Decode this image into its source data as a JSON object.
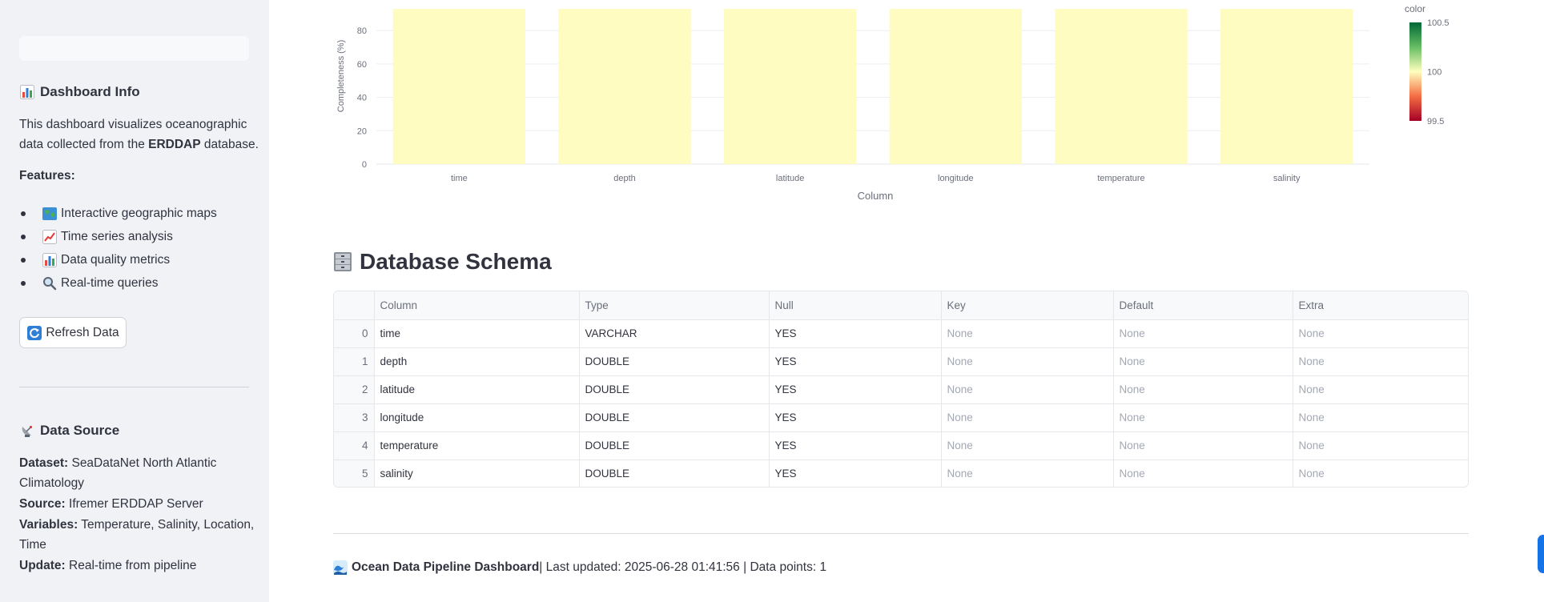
{
  "sidebar": {
    "dashboard_info": {
      "heading": "Dashboard Info",
      "description_prefix": "This dashboard visualizes oceanographic data collected from the ",
      "description_bold": "ERDDAP",
      "description_suffix": " database.",
      "features_label": "Features:",
      "features": [
        {
          "icon": "world-map-icon",
          "label": "Interactive geographic maps"
        },
        {
          "icon": "chart-increasing-icon",
          "label": "Time series analysis"
        },
        {
          "icon": "bar-chart-icon",
          "label": "Data quality metrics"
        },
        {
          "icon": "magnifier-icon",
          "label": "Real-time queries"
        }
      ]
    },
    "refresh_button": "Refresh Data",
    "data_source": {
      "heading": "Data Source",
      "dataset_label": "Dataset:",
      "dataset_value": " SeaDataNet North Atlantic Climatology",
      "source_label": "Source:",
      "source_value": " Ifremer ERDDAP Server",
      "variables_label": "Variables:",
      "variables_value": " Temperature, Salinity, Location, Time",
      "update_label": "Update:",
      "update_value": " Real-time from pipeline"
    }
  },
  "chart_data": {
    "type": "bar",
    "categories": [
      "time",
      "depth",
      "latitude",
      "longitude",
      "temperature",
      "salinity"
    ],
    "values": [
      100,
      100,
      100,
      100,
      100,
      100
    ],
    "xlabel": "Column",
    "ylabel": "Completeness (%)",
    "yticks": [
      0,
      20,
      40,
      60,
      80
    ],
    "ylim": [
      0,
      93
    ],
    "grid": true,
    "colorbar": {
      "title": "color",
      "ticks": [
        "100.5",
        "100",
        "99.5"
      ],
      "range": [
        99.5,
        100.5
      ]
    },
    "bar_color": "#fefcc0"
  },
  "schema": {
    "heading": "Database Schema",
    "columns": [
      "",
      "Column",
      "Type",
      "Null",
      "Key",
      "Default",
      "Extra"
    ],
    "rows": [
      [
        "0",
        "time",
        "VARCHAR",
        "YES",
        "None",
        "None",
        "None"
      ],
      [
        "1",
        "depth",
        "DOUBLE",
        "YES",
        "None",
        "None",
        "None"
      ],
      [
        "2",
        "latitude",
        "DOUBLE",
        "YES",
        "None",
        "None",
        "None"
      ],
      [
        "3",
        "longitude",
        "DOUBLE",
        "YES",
        "None",
        "None",
        "None"
      ],
      [
        "4",
        "temperature",
        "DOUBLE",
        "YES",
        "None",
        "None",
        "None"
      ],
      [
        "5",
        "salinity",
        "DOUBLE",
        "YES",
        "None",
        "None",
        "None"
      ]
    ]
  },
  "footer": {
    "title": "Ocean Data Pipeline Dashboard",
    "rest": " | Last updated: 2025-06-28 01:41:56 | Data points: 1"
  },
  "colors": {
    "sidebar_bg": "#f0f2f6",
    "text": "#31333f",
    "bar_fill": "#fefcc0",
    "accent_blue": "#1473e6"
  }
}
